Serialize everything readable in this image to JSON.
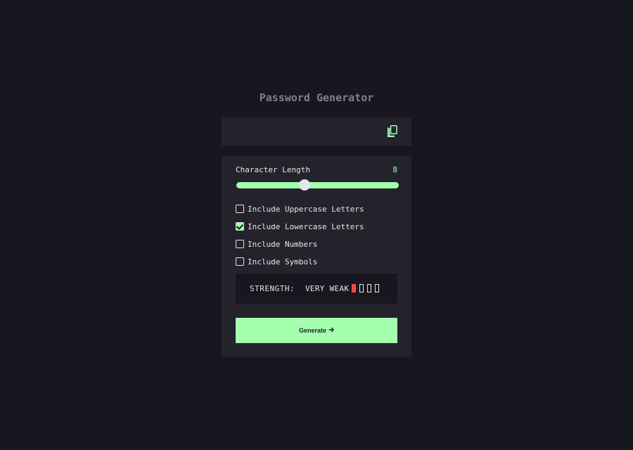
{
  "app": {
    "title": "Password Generator"
  },
  "output": {
    "password": "",
    "copy_icon": "copy-icon"
  },
  "length": {
    "label": "Character Length",
    "value": "8",
    "min": 0,
    "max": 20
  },
  "options": [
    {
      "label": "Include Uppercase Letters",
      "checked": false
    },
    {
      "label": "Include Lowercase Letters",
      "checked": true
    },
    {
      "label": "Include Numbers",
      "checked": false
    },
    {
      "label": "Include Symbols",
      "checked": false
    }
  ],
  "strength": {
    "label": "STRENGTH:",
    "rating": "VERY WEAK",
    "level": 1,
    "levels_total": 4,
    "color": "#f64a4a"
  },
  "generate": {
    "label": "Generate",
    "icon": "arrow-right-icon"
  },
  "colors": {
    "accent": "#a4ffaf",
    "background": "#18171f",
    "panel": "#24232c",
    "muted": "#817d92"
  }
}
